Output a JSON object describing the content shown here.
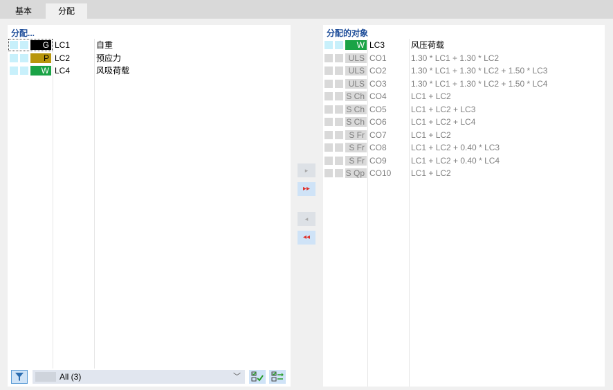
{
  "tabs": [
    {
      "label": "基本"
    },
    {
      "label": "分配"
    }
  ],
  "left_panel": {
    "title": "分配...",
    "items": [
      {
        "badge": "G",
        "badge_bg": "#000000",
        "badge_fg": "#ffffff",
        "id": "LC1",
        "desc": "自重"
      },
      {
        "badge": "P",
        "badge_bg": "#b8960c",
        "badge_fg": "#000000",
        "id": "LC2",
        "desc": "预应力"
      },
      {
        "badge": "W",
        "badge_bg": "#1aa346",
        "badge_fg": "#ffffff",
        "id": "LC4",
        "desc": "风吸荷载"
      }
    ],
    "filter": {
      "value": "All (3)",
      "chevron": "﹀"
    }
  },
  "transfer_buttons": [
    {
      "name": "add-selected",
      "glyph": "▸",
      "state": "disabled"
    },
    {
      "name": "add-all",
      "glyph": "▸▸",
      "state": "active"
    },
    {
      "name": "remove-selected",
      "glyph": "◂",
      "state": "disabled"
    },
    {
      "name": "remove-all",
      "glyph": "◂◂",
      "state": "active"
    }
  ],
  "right_panel": {
    "title": "分配的对象",
    "items": [
      {
        "badge": "W",
        "badge_bg": "#1aa346",
        "badge_fg": "#ffffff",
        "id": "LC3",
        "desc": "风压荷载",
        "muted": false
      },
      {
        "badge": "ULS",
        "id": "CO1",
        "desc": "1.30 * LC1 + 1.30 * LC2",
        "muted": true
      },
      {
        "badge": "ULS",
        "id": "CO2",
        "desc": "1.30 * LC1 + 1.30 * LC2 + 1.50 * LC3",
        "muted": true
      },
      {
        "badge": "ULS",
        "id": "CO3",
        "desc": "1.30 * LC1 + 1.30 * LC2 + 1.50 * LC4",
        "muted": true
      },
      {
        "badge": "S Ch",
        "id": "CO4",
        "desc": "LC1 + LC2",
        "muted": true
      },
      {
        "badge": "S Ch",
        "id": "CO5",
        "desc": "LC1 + LC2 + LC3",
        "muted": true
      },
      {
        "badge": "S Ch",
        "id": "CO6",
        "desc": "LC1 + LC2 + LC4",
        "muted": true
      },
      {
        "badge": "S Fr",
        "id": "CO7",
        "desc": "LC1 + LC2",
        "muted": true
      },
      {
        "badge": "S Fr",
        "id": "CO8",
        "desc": "LC1 + LC2 + 0.40 * LC3",
        "muted": true
      },
      {
        "badge": "S Fr",
        "id": "CO9",
        "desc": "LC1 + LC2 + 0.40 * LC4",
        "muted": true
      },
      {
        "badge": "S Qp",
        "id": "CO10",
        "desc": "LC1 + LC2",
        "muted": true
      }
    ]
  }
}
